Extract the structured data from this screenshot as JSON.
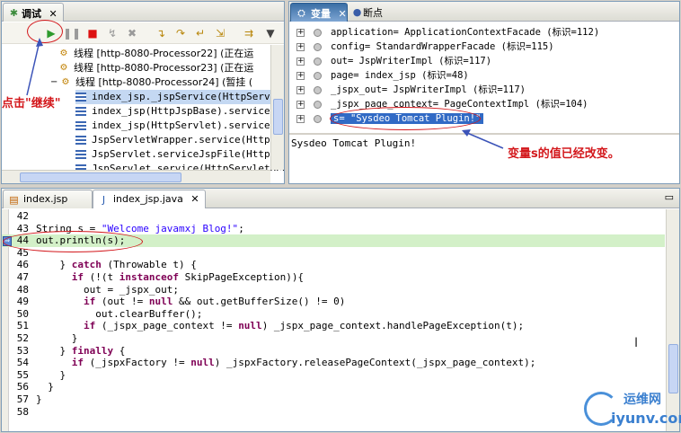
{
  "debug_panel": {
    "tab_label": "调试",
    "threads": [
      {
        "label": "线程 [http-8080-Processor22] (正在运"
      },
      {
        "label": "线程 [http-8080-Processor23] (正在运"
      },
      {
        "label": "线程 [http-8080-Processor24] (暂挂 ("
      }
    ],
    "frames": [
      "index_jsp._jspService(HttpServlet",
      "index_jsp(HttpJspBase).service(Ht",
      "index_jsp(HttpServlet).service(Se",
      "JspServletWrapper.service(HttpSer",
      "JspServlet.serviceJspFile(HttpSer",
      "JspServlet.service(HttpServletReq"
    ],
    "toolbar_icons": [
      "resume-icon",
      "suspend-icon",
      "terminate-icon",
      "disconnect-icon",
      "remove-icon",
      "step-into-icon",
      "step-over-icon",
      "step-return-icon",
      "drop-to-frame-icon",
      "use-step-filters-icon",
      "menu-icon"
    ]
  },
  "variables_panel": {
    "tab_variables": "变量",
    "tab_breakpoints": "断点",
    "rows": [
      "application= ApplicationContextFacade  (标识=112)",
      "config= StandardWrapperFacade  (标识=115)",
      "out= JspWriterImpl  (标识=117)",
      "page= index_jsp  (标识=48)",
      "_jspx_out= JspWriterImpl  (标识=117)",
      "_jspx_page_context= PageContextImpl  (标识=104)",
      "s= \"Sysdeo Tomcat Plugin!\""
    ],
    "detail_text": "Sysdeo Tomcat Plugin!"
  },
  "editor": {
    "tabs": [
      {
        "label": "index.jsp"
      },
      {
        "label": "index_jsp.java"
      }
    ],
    "lines": [
      {
        "n": "42",
        "text": ""
      },
      {
        "n": "43",
        "text": "String s = \"Welcome javamxj Blog!\";"
      },
      {
        "n": "44",
        "text": "out.println(s);"
      },
      {
        "n": "45",
        "text": ""
      },
      {
        "n": "46",
        "text": "    } catch (Throwable t) {"
      },
      {
        "n": "47",
        "text": "      if (!(t instanceof SkipPageException)){"
      },
      {
        "n": "48",
        "text": "        out = _jspx_out;"
      },
      {
        "n": "49",
        "text": "        if (out != null && out.getBufferSize() != 0)"
      },
      {
        "n": "50",
        "text": "          out.clearBuffer();"
      },
      {
        "n": "51",
        "text": "        if (_jspx_page_context != null) _jspx_page_context.handlePageException(t);"
      },
      {
        "n": "52",
        "text": "      }"
      },
      {
        "n": "53",
        "text": "    } finally {"
      },
      {
        "n": "54",
        "text": "      if (_jspxFactory != null) _jspxFactory.releasePageContext(_jspx_page_context);"
      },
      {
        "n": "55",
        "text": "    }"
      },
      {
        "n": "56",
        "text": "  }"
      },
      {
        "n": "57",
        "text": "}"
      },
      {
        "n": "58",
        "text": ""
      }
    ]
  },
  "annotations": {
    "resume_note": "点击\"继续\"",
    "value_changed_note": "变量s的值已经改变。"
  },
  "watermark": {
    "cn": "运维网",
    "en": "iyunv.com"
  },
  "colors": {
    "annotation_red": "#d3171b",
    "selection_blue": "#316ac5",
    "keyword": "#7f0055",
    "string": "#2a00ff",
    "current_line": "#d3f0c8"
  }
}
